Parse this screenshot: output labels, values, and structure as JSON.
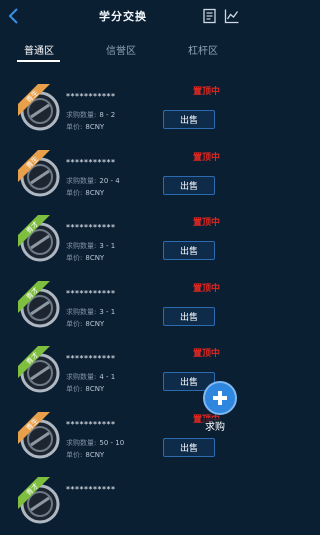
{
  "header": {
    "title": "学分交换",
    "back_icon": "chevron-left-icon",
    "icons": [
      "notes-icon",
      "chart-icon"
    ]
  },
  "tabs": [
    {
      "label": "普通区",
      "active": true
    },
    {
      "label": "信誉区",
      "active": false
    },
    {
      "label": "杠杆区",
      "active": false
    }
  ],
  "listings": [
    {
      "badge": "青生",
      "badge_color": "#e8a04a",
      "account": "***********",
      "pinned": "置顶中",
      "quantity_label": "求购数量:",
      "quantity": "8 - 2",
      "price_label": "单价:",
      "price": "8CNY",
      "action": "出售"
    },
    {
      "badge": "青生",
      "badge_color": "#e8a04a",
      "account": "***********",
      "pinned": "置顶中",
      "quantity_label": "求购数量:",
      "quantity": "20 - 4",
      "price_label": "单价:",
      "price": "8CNY",
      "action": "出售"
    },
    {
      "badge": "青才",
      "badge_color": "#7fbf3f",
      "account": "***********",
      "pinned": "置顶中",
      "quantity_label": "求购数量:",
      "quantity": "3 - 1",
      "price_label": "单价:",
      "price": "8CNY",
      "action": "出售"
    },
    {
      "badge": "青才",
      "badge_color": "#7fbf3f",
      "account": "***********",
      "pinned": "置顶中",
      "quantity_label": "求购数量:",
      "quantity": "3 - 1",
      "price_label": "单价:",
      "price": "8CNY",
      "action": "出售"
    },
    {
      "badge": "青才",
      "badge_color": "#7fbf3f",
      "account": "***********",
      "pinned": "置顶中",
      "quantity_label": "求购数量:",
      "quantity": "4 - 1",
      "price_label": "单价:",
      "price": "8CNY",
      "action": "出售"
    },
    {
      "badge": "青生",
      "badge_color": "#e8a04a",
      "account": "***********",
      "pinned": "置顶中",
      "quantity_label": "求购数量:",
      "quantity": "50 - 10",
      "price_label": "单价:",
      "price": "8CNY",
      "action": "出售"
    },
    {
      "badge": "青才",
      "badge_color": "#7fbf3f",
      "account": "***********",
      "pinned": "",
      "quantity_label": "",
      "quantity": "",
      "price_label": "",
      "price": "",
      "action": ""
    }
  ],
  "fab": {
    "label": "求购",
    "icon": "plus-icon"
  },
  "colors": {
    "background": "#0b1f33",
    "pinned": "#e0261f",
    "button_border": "#2c6bb0",
    "fab": "#2e86de"
  }
}
